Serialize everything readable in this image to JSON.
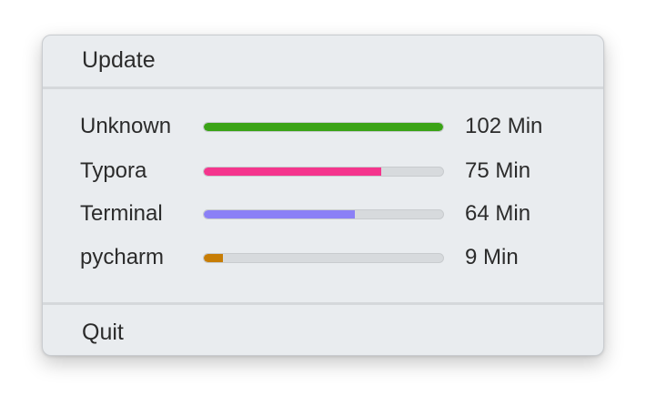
{
  "menu": {
    "update_label": "Update",
    "quit_label": "Quit"
  },
  "usage": [
    {
      "app": "Unknown",
      "duration": "102 Min",
      "fraction": 1.0,
      "color": "#3aa316"
    },
    {
      "app": "Typora",
      "duration": "75 Min",
      "fraction": 0.74,
      "color": "#f4358d"
    },
    {
      "app": "Terminal",
      "duration": "64 Min",
      "fraction": 0.63,
      "color": "#8b80f6"
    },
    {
      "app": "pycharm",
      "duration": "9 Min",
      "fraction": 0.08,
      "color": "#c77d05"
    }
  ]
}
